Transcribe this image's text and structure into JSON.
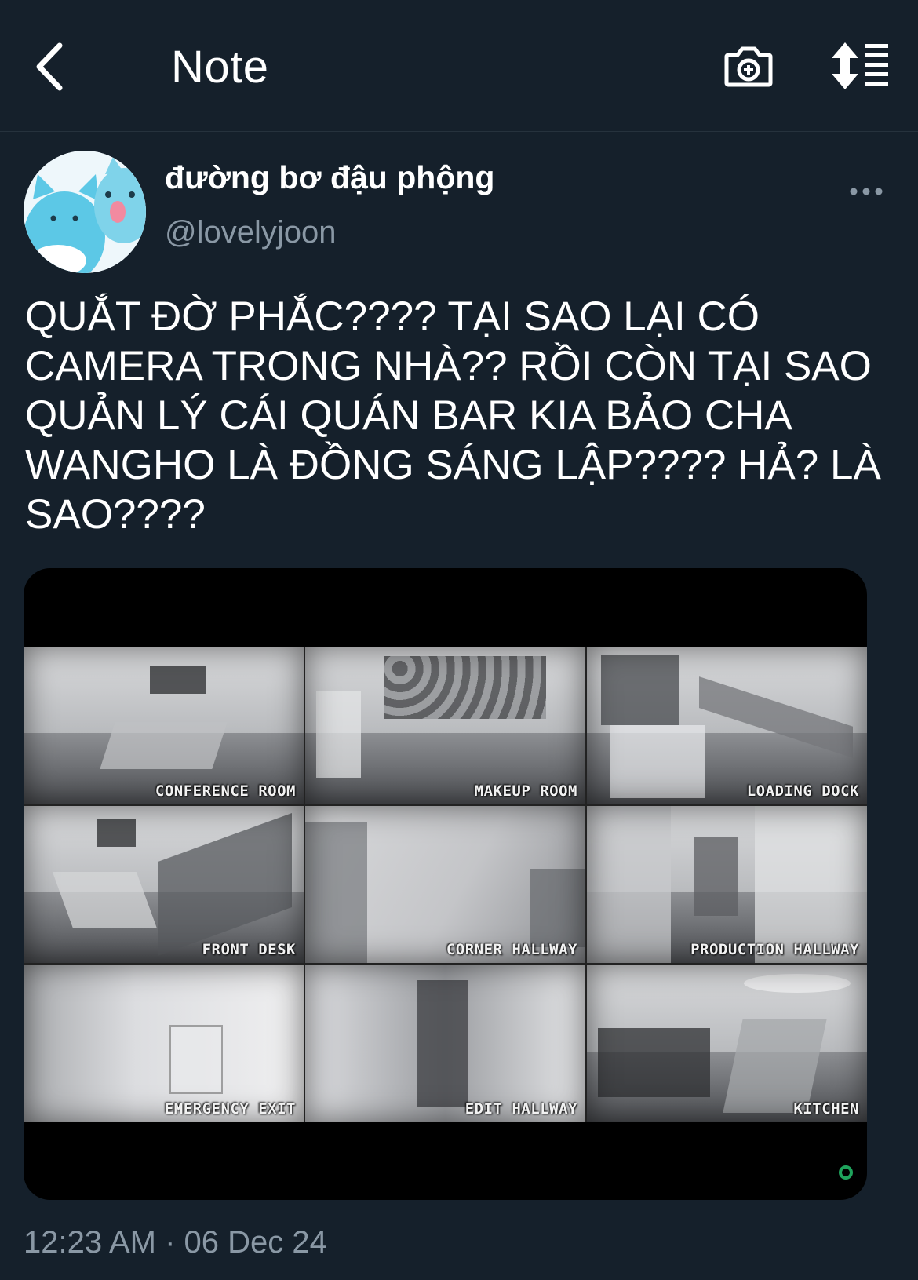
{
  "header": {
    "title": "Note",
    "back_icon": "chevron-left-icon",
    "camera_icon": "camera-plus-icon",
    "sort_icon": "sort-list-icon"
  },
  "tweet": {
    "display_name": "đường bơ đậu phộng",
    "handle": "@lovelyjoon",
    "text": "QUẮT ĐỜ PHẮC???? TẠI SAO LẠI CÓ\nCAMERA TRONG NHÀ?? RỒI CÒN TẠI SAO\nQUẢN LÝ CÁI QUÁN BAR KIA BẢO CHA\nWANGHO LÀ ĐỒNG SÁNG LẬP???? HẢ? LÀ\nSAO????",
    "timestamp": "12:23 AM · 06 Dec 24"
  },
  "media": {
    "cameras": [
      {
        "label": "CONFERENCE ROOM"
      },
      {
        "label": "MAKEUP ROOM"
      },
      {
        "label": "LOADING DOCK"
      },
      {
        "label": "FRONT DESK"
      },
      {
        "label": "CORNER HALLWAY"
      },
      {
        "label": "PRODUCTION HALLWAY"
      },
      {
        "label": "EMERGENCY EXIT"
      },
      {
        "label": "EDIT HALLWAY"
      },
      {
        "label": "KITCHEN"
      }
    ],
    "recording_color": "#1fa35c"
  },
  "colors": {
    "background": "#15202b",
    "secondary_text": "#8a98a5"
  }
}
